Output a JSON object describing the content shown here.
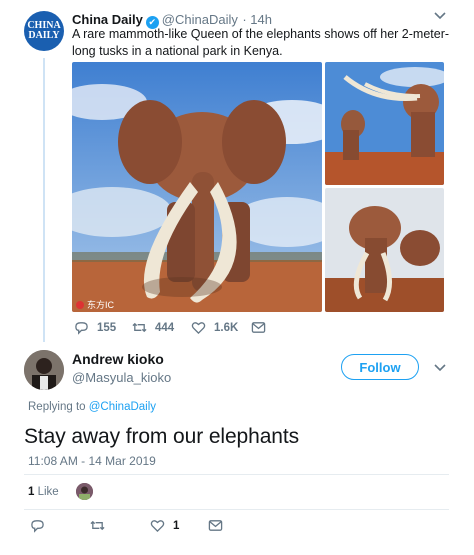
{
  "tweet": {
    "avatar_text_1": "CHINA",
    "avatar_text_2": "DAILY",
    "name": "China Daily",
    "handle": "@ChinaDaily",
    "time": "· 14h",
    "text": "A rare mammoth-like Queen of the elephants shows off her 2-meter-long tusks in a national park in Kenya.",
    "watermark": "东方IC",
    "actions": {
      "replies": "155",
      "retweets": "444",
      "likes": "1.6K"
    }
  },
  "reply": {
    "name": "Andrew kioko",
    "handle": "@Masyula_kioko",
    "follow_label": "Follow",
    "replying_prefix": "Replying to",
    "replying_handle": "@ChinaDaily",
    "text": "Stay away from our elephants",
    "timestamp": "11:08 AM - 14 Mar 2019",
    "like_count": "1",
    "like_label": "Like",
    "actions": {
      "likes": "1"
    }
  },
  "icons": [
    "verified-icon",
    "chevron-down-icon",
    "reply-icon",
    "retweet-icon",
    "like-icon",
    "message-icon"
  ],
  "colors": {
    "accent": "#1da1f2",
    "muted": "#657786",
    "thread_line": "#cfe3f5",
    "china_daily_blue": "#1a5fb0"
  }
}
